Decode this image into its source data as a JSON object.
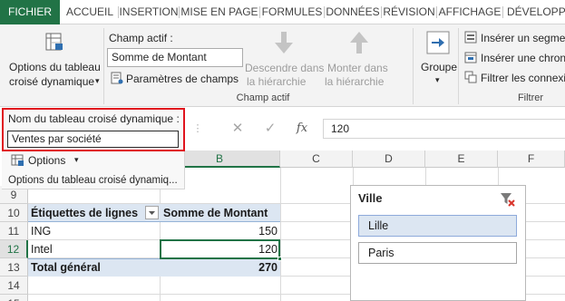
{
  "ribbon_tabs": [
    "FICHIER",
    "ACCUEIL",
    "INSERTION",
    "MISE EN PAGE",
    "FORMULES",
    "DONNÉES",
    "RÉVISION",
    "AFFICHAGE",
    "DÉVELOPPEI"
  ],
  "ribbon": {
    "pivot_options": {
      "line1": "Options du tableau",
      "line2": "croisé dynamique",
      "arrow": "▾"
    },
    "active_field": {
      "label": "Champ actif :",
      "value": "Somme de Montant",
      "field_settings": "Paramètres de champs",
      "drill_down_line1": "Descendre dans",
      "drill_down_line2": "la hiérarchie",
      "drill_up_line1": "Monter dans",
      "drill_up_line2": "la hiérarchie",
      "group_title": "Champ actif"
    },
    "group": {
      "label": "Groupe",
      "arrow": "▾"
    },
    "filter": {
      "insert_slicer": "Insérer un segme",
      "insert_timeline": "Insérer une chron",
      "filter_connections": "Filtrer les connexi",
      "group_title": "Filtrer"
    }
  },
  "pivot_name_panel": {
    "label": "Nom du tableau croisé dynamique :",
    "value": "Ventes par société",
    "options_button": "Options",
    "options_arrow": "▾",
    "group_title": "Options du tableau croisé dynamiq..."
  },
  "formula_bar": {
    "cancel_icon": "✕",
    "enter_icon": "✓",
    "fx_icon": "fx",
    "value": "120"
  },
  "columns": [
    "B",
    "C",
    "D",
    "E",
    "F"
  ],
  "selected_column": "B",
  "rows": [
    "9",
    "10",
    "11",
    "12",
    "13",
    "14",
    "15"
  ],
  "selected_row": "12",
  "pivot_table": {
    "header_label": "Étiquettes de lignes",
    "header_value": "Somme de Montant",
    "rows": [
      {
        "label": "ING",
        "value": "150"
      },
      {
        "label": "Intel",
        "value": "120"
      }
    ],
    "total_label": "Total général",
    "total_value": "270"
  },
  "slicer": {
    "title": "Ville",
    "items": [
      {
        "label": "Lille",
        "selected": true
      },
      {
        "label": "Paris",
        "selected": false
      }
    ]
  },
  "colors": {
    "file_tab": "#217346",
    "highlight_border": "#e0141e",
    "selection": "#217346",
    "pivot_band": "#dce6f2"
  }
}
